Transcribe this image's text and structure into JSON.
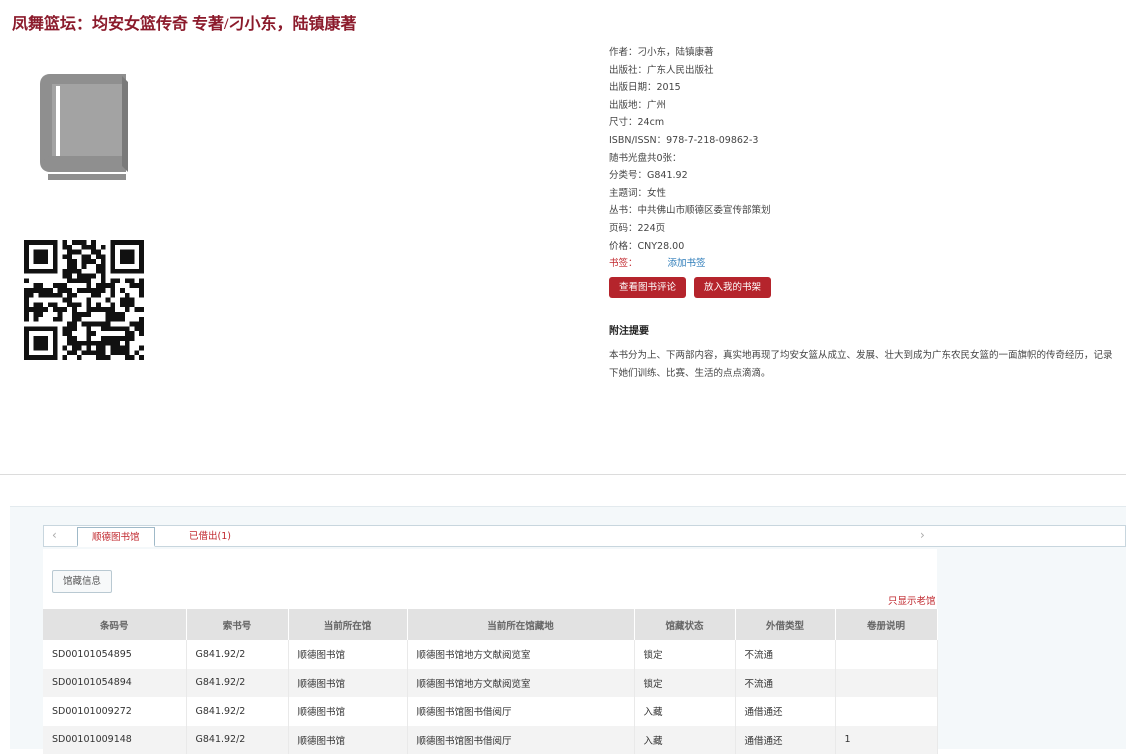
{
  "book": {
    "title": "凤舞篮坛：均安女篮传奇 专著/刁小东，陆镇康著"
  },
  "metadata": [
    {
      "label": "作者：",
      "value": "刁小东，陆镇康著"
    },
    {
      "label": "出版社：",
      "value": "广东人民出版社"
    },
    {
      "label": "出版日期：",
      "value": "2015"
    },
    {
      "label": "出版地：",
      "value": "广州"
    },
    {
      "label": "尺寸：",
      "value": "24cm"
    },
    {
      "label": "ISBN/ISSN：",
      "value": "978-7-218-09862-3"
    },
    {
      "label": "随书光盘共0张：",
      "value": ""
    },
    {
      "label": "分类号：",
      "value": "G841.92"
    },
    {
      "label": "主题词：",
      "value": "女性"
    },
    {
      "label": "丛书：",
      "value": "中共佛山市顺德区委宣传部策划"
    },
    {
      "label": "页码：",
      "value": "224页"
    },
    {
      "label": "价格：",
      "value": "CNY28.00"
    }
  ],
  "tags": {
    "label": "书签：",
    "add_link": "添加书签"
  },
  "buttons": {
    "view_reviews": "查看图书评论",
    "add_shelf": "放入我的书架"
  },
  "abstract": {
    "heading": "附注提要",
    "text": "本书分为上、下两部内容，真实地再现了均安女篮从成立、发展、壮大到成为广东农民女篮的一面旗帜的传奇经历，记录下她们训练、比赛、生活的点点滴滴。"
  },
  "tabs": {
    "library": "顺德图书馆",
    "borrowed": "已借出(1)"
  },
  "subtab": "馆藏信息",
  "only_show_label": "只显示老馆",
  "table": {
    "headers": [
      "条码号",
      "索书号",
      "当前所在馆",
      "当前所在馆藏地",
      "馆藏状态",
      "外借类型",
      "卷册说明"
    ],
    "rows": [
      [
        "SD00101054895",
        "G841.92/2",
        "顺德图书馆",
        "顺德图书馆地方文献阅览室",
        "锁定",
        "不流通",
        ""
      ],
      [
        "SD00101054894",
        "G841.92/2",
        "顺德图书馆",
        "顺德图书馆地方文献阅览室",
        "锁定",
        "不流通",
        ""
      ],
      [
        "SD00101009272",
        "G841.92/2",
        "顺德图书馆",
        "顺德图书馆图书借阅厅",
        "入藏",
        "通借通还",
        ""
      ],
      [
        "SD00101009148",
        "G841.92/2",
        "顺德图书馆",
        "顺德图书馆图书借阅厅",
        "入藏",
        "通借通还",
        "1"
      ]
    ]
  }
}
